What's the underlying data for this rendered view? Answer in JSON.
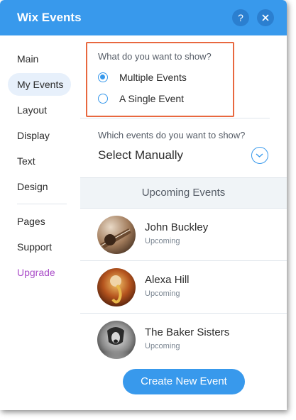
{
  "header": {
    "title": "Wix Events",
    "help_icon": "?",
    "close_icon": "✕"
  },
  "sidebar": {
    "items": [
      {
        "label": "Main"
      },
      {
        "label": "My Events",
        "selected": true
      },
      {
        "label": "Layout"
      },
      {
        "label": "Display"
      },
      {
        "label": "Text"
      },
      {
        "label": "Design"
      },
      {
        "label": "Pages"
      },
      {
        "label": "Support"
      },
      {
        "label": "Upgrade"
      }
    ]
  },
  "show": {
    "question": "What do you want to show?",
    "options": [
      {
        "label": "Multiple Events",
        "selected": true
      },
      {
        "label": "A Single Event",
        "selected": false
      }
    ]
  },
  "which": {
    "question": "Which events do you want to show?",
    "value": "Select Manually"
  },
  "events": {
    "header": "Upcoming Events",
    "items": [
      {
        "title": "John Buckley",
        "status": "Upcoming",
        "image": "guitar-player-photo"
      },
      {
        "title": "Alexa Hill",
        "status": "Upcoming",
        "image": "saxophone-player-photo"
      },
      {
        "title": "The Baker Sisters",
        "status": "Upcoming",
        "image": "singer-photo"
      }
    ]
  },
  "create_button": "Create New Event",
  "colors": {
    "accent": "#3899ec",
    "upgrade": "#aa4dc8",
    "highlight": "#e8683f"
  }
}
